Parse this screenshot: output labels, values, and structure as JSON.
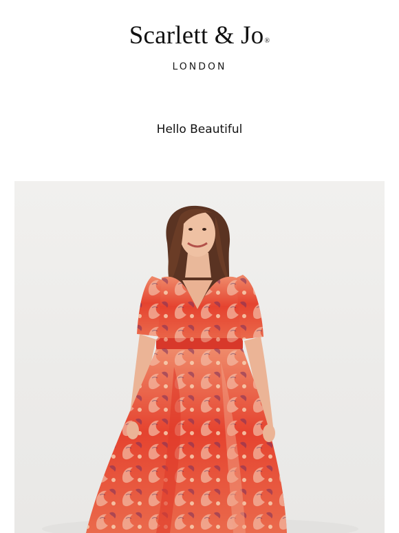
{
  "header": {
    "brand_name": "Scarlett & Jo",
    "brand_mark": "®",
    "brand_subtitle": "LONDON"
  },
  "greeting": "Hello Beautiful",
  "hero": {
    "icon": "model-in-red-paisley-maxi-dress-photo",
    "colors": {
      "background": "#eeedeb",
      "dress_primary": "#e5432f",
      "dress_accent": "#f3b6a0",
      "hair": "#5a3322"
    }
  }
}
